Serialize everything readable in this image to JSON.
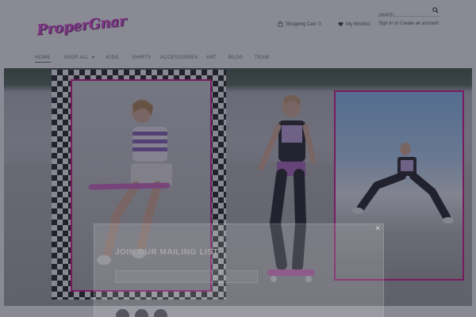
{
  "header": {
    "logo_text": "ProperGnar",
    "search": {
      "placeholder": "Search"
    },
    "links": {
      "cart": "Shopping Cart",
      "cart_count": "0",
      "wishlist": "My Wishlist",
      "account": "Sign in or Create an account"
    }
  },
  "nav": {
    "items": [
      {
        "label": "Home"
      },
      {
        "label": "Shop All"
      },
      {
        "label": "Kids"
      },
      {
        "label": "Shirts"
      },
      {
        "label": "Accessories"
      },
      {
        "label": "Art"
      },
      {
        "label": "Blog"
      },
      {
        "label": "Team"
      }
    ]
  },
  "modal": {
    "title": "Join our mailing list",
    "email_placeholder": ""
  },
  "colors": {
    "brand_pink": "#e052d8",
    "frame_pink": "#d81d8f",
    "overlay": "rgba(25,25,45,0.5)"
  }
}
